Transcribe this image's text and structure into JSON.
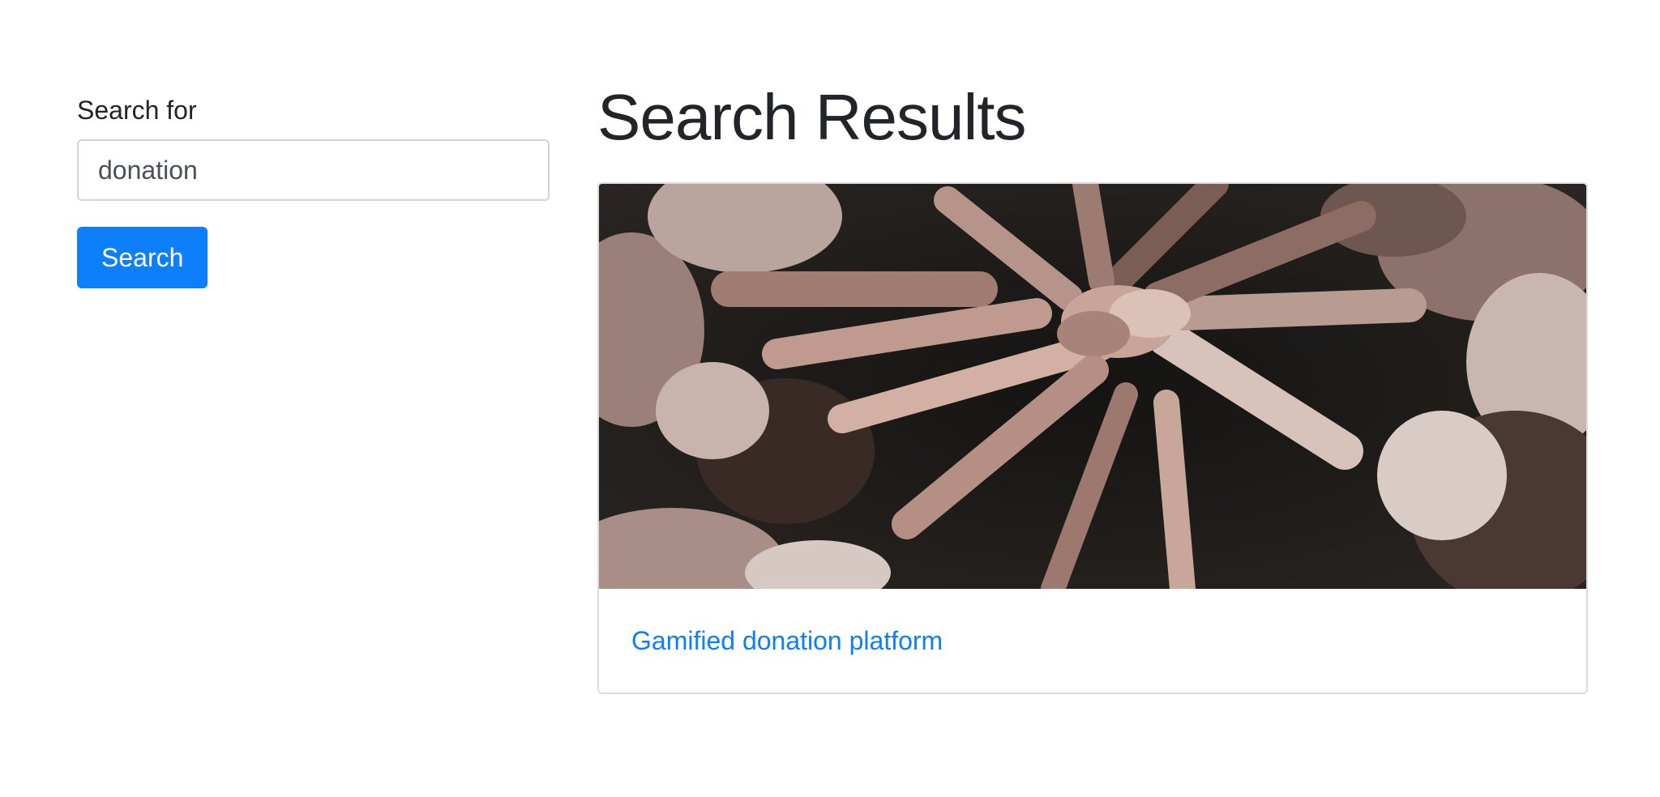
{
  "search": {
    "label": "Search for",
    "value": "donation",
    "button_label": "Search"
  },
  "main": {
    "title": "Search Results",
    "results": [
      {
        "title": "Gamified donation platform",
        "image_alt": "hands-stacked-team-photo"
      }
    ]
  },
  "colors": {
    "accent": "#0d7ffb",
    "text": "#212529",
    "border": "#ced4da"
  }
}
